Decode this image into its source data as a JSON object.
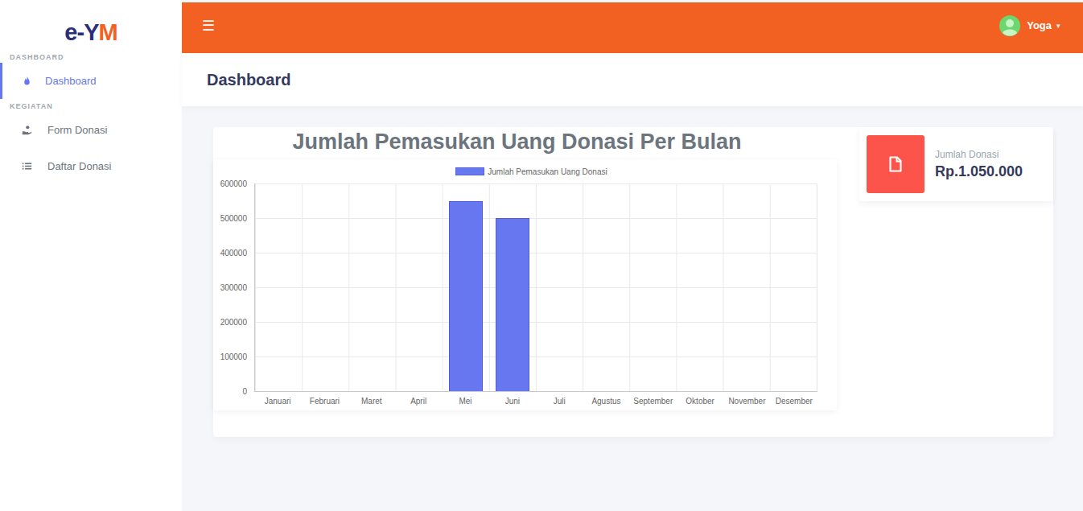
{
  "logo": [
    {
      "text": "e-Y",
      "color": "#2b2f7a"
    },
    {
      "text": "M",
      "color": "#f26022"
    }
  ],
  "topbar": {
    "menu_icon": "☰",
    "user": {
      "name": "Yoga",
      "caret": "▾"
    }
  },
  "sidebar": {
    "sections": [
      {
        "header": "DASHBOARD",
        "items": [
          {
            "label": "Dashboard",
            "selected": true
          }
        ]
      },
      {
        "header": "KEGIATAN",
        "items": [
          {
            "label": "Form Donasi",
            "selected": false
          },
          {
            "label": "Daftar Donasi",
            "selected": false
          }
        ]
      }
    ]
  },
  "page_title": "Dashboard",
  "chart": {
    "title": "Jumlah Pemasukan Uang Donasi Per Bulan",
    "y_max": 600000,
    "y_ticks": [
      "600000",
      "500000",
      "400000",
      "300000",
      "200000",
      "100000",
      "0"
    ],
    "months": [
      "Januari",
      "Februari",
      "Maret",
      "April",
      "Mei",
      "Juni",
      "Juli",
      "Agustus",
      "September",
      "Oktober",
      "November",
      "Desember"
    ],
    "series": [
      {
        "name": "Jumlah Pemasukan Uang Donasi",
        "values": [
          0,
          0,
          0,
          0,
          550000,
          500000,
          0,
          0,
          0,
          0,
          0,
          0
        ]
      }
    ]
  },
  "stat": {
    "label": "Jumlah Donasi",
    "value": "Rp.1.050.000"
  }
}
